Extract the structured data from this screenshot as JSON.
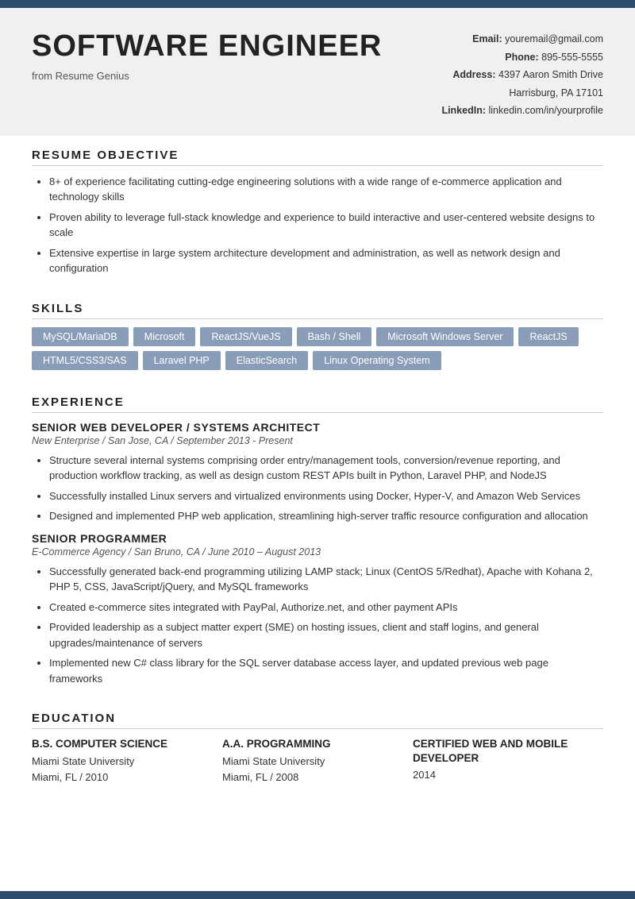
{
  "header": {
    "top_bar_color": "#2e4a6b",
    "name": "SOFTWARE ENGINEER",
    "subtitle": "from Resume Genius",
    "email_label": "Email:",
    "email_value": "youremail@gmail.com",
    "phone_label": "Phone:",
    "phone_value": "895-555-5555",
    "address_label": "Address:",
    "address_value": "4397 Aaron Smith Drive",
    "address_city": "Harrisburg, PA 17101",
    "linkedin_label": "LinkedIn:",
    "linkedin_value": "linkedin.com/in/yourprofile"
  },
  "resume_objective": {
    "title": "RESUME OBJECTIVE",
    "bullets": [
      "8+ of experience facilitating cutting-edge engineering solutions with a wide range of e-commerce application and technology skills",
      "Proven ability to leverage full-stack knowledge and experience to build interactive and user-centered website designs to scale",
      "Extensive expertise in large system architecture development and administration, as well as network design and configuration"
    ]
  },
  "skills": {
    "title": "SKILLS",
    "tags": [
      "MySQL/MariaDB",
      "Microsoft",
      "ReactJS/VueJS",
      "Bash / Shell",
      "Microsoft Windows Server",
      "ReactJS",
      "HTML5/CSS3/SAS",
      "Laravel PHP",
      "ElasticSearch",
      "Linux Operating System"
    ]
  },
  "experience": {
    "title": "EXPERIENCE",
    "jobs": [
      {
        "title": "SENIOR WEB DEVELOPER / SYSTEMS ARCHITECT",
        "company": "New Enterprise / San Jose, CA / September 2013 - Present",
        "bullets": [
          "Structure several internal systems comprising order entry/management tools, conversion/revenue reporting, and production workflow tracking, as well as design custom REST APIs built in Python, Laravel PHP, and NodeJS",
          "Successfully installed Linux servers and virtualized environments using Docker, Hyper-V, and Amazon Web Services",
          "Designed and implemented PHP web application, streamlining high-server traffic resource configuration and allocation"
        ]
      },
      {
        "title": "SENIOR PROGRAMMER",
        "company": "E-Commerce Agency / San Bruno, CA / June 2010 – August 2013",
        "bullets": [
          "Successfully generated back-end programming utilizing LAMP stack; Linux (CentOS 5/Redhat), Apache with Kohana 2, PHP 5, CSS, JavaScript/jQuery, and MySQL frameworks",
          "Created e-commerce sites integrated with PayPal, Authorize.net, and other payment APIs",
          "Provided leadership as a subject matter expert (SME) on hosting issues, client and staff logins, and general upgrades/maintenance of servers",
          "Implemented new C# class library for the SQL server database access layer, and updated previous web page frameworks"
        ]
      }
    ]
  },
  "education": {
    "title": "EDUCATION",
    "entries": [
      {
        "degree": "B.S. COMPUTER SCIENCE",
        "school": "Miami State University",
        "location_year": "Miami, FL / 2010"
      },
      {
        "degree": "A.A. PROGRAMMING",
        "school": "Miami State University",
        "location_year": "Miami, FL / 2008"
      },
      {
        "degree": "CERTIFIED WEB AND MOBILE DEVELOPER",
        "school": "",
        "location_year": "2014"
      }
    ]
  }
}
